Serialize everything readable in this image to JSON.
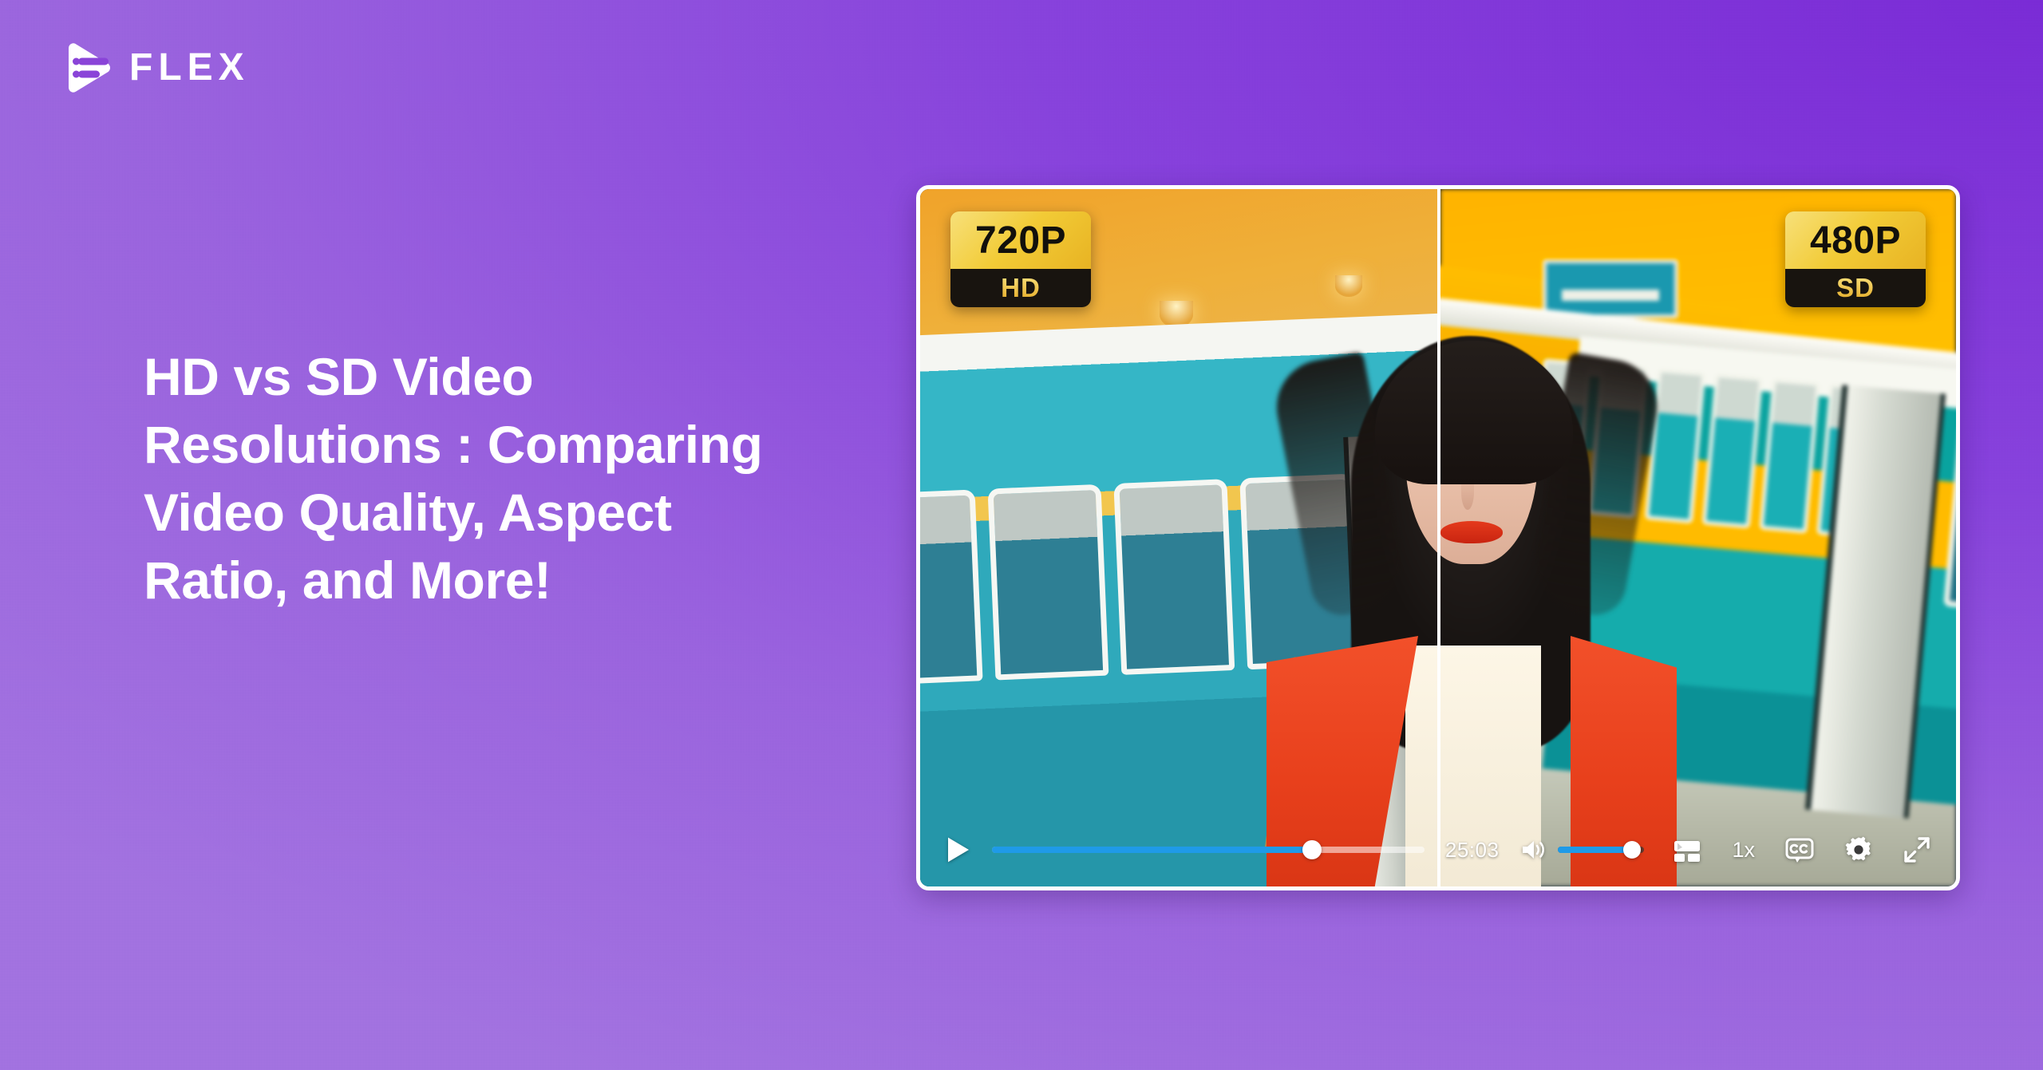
{
  "brand": {
    "name": "FLEX",
    "logo_icon": "flex-play-mark-icon"
  },
  "headline": {
    "text": "HD vs SD Video Resolutions : Comparing Video Quality, Aspect Ratio, and More!"
  },
  "colors": {
    "background_top_right": "#7a2bd6",
    "background_bottom_left": "#a272e0",
    "accent_blue": "#1f9ae8",
    "badge_gold": "#f2cb36",
    "badge_dark": "#18140f",
    "player_border": "#ffffff"
  },
  "player": {
    "comparison": {
      "left": {
        "resolution": "720P",
        "quality": "HD"
      },
      "right": {
        "resolution": "480P",
        "quality": "SD"
      }
    },
    "controls": {
      "play_icon": "play-icon",
      "progress_percent": 74,
      "time": "25:03",
      "volume_icon": "volume-high-icon",
      "volume_percent": 86,
      "miniplayer_icon": "miniplayer-icon",
      "speed_label": "1x",
      "captions_label": "CC",
      "captions_icon": "closed-captions-icon",
      "settings_icon": "gear-icon",
      "fullscreen_icon": "expand-arrows-icon"
    }
  }
}
